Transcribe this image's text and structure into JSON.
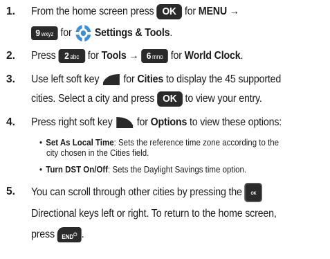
{
  "step1": {
    "num": "1.",
    "line1_a": "From the home screen press",
    "key_ok": "OK",
    "line1_b": "for",
    "menu": "MENU",
    "arrow": "→",
    "key9_digit": "9",
    "key9_letters": "wxyz",
    "line2_a": "for",
    "settings": "Settings & Tools",
    "line2_end": "."
  },
  "step2": {
    "num": "2.",
    "press": "Press",
    "key2_digit": "2",
    "key2_letters": "abc",
    "for1": "for",
    "tools": "Tools",
    "arrow": "→",
    "key6_digit": "6",
    "key6_letters": "mno",
    "for2": "for",
    "world_clock": "World Clock",
    "end": "."
  },
  "step3": {
    "num": "3.",
    "line1_a": "Use left soft key",
    "for": "for",
    "cities": "Cities",
    "line1_b": "to display the 45 supported",
    "line2_a": "cities. Select a city and press",
    "key_ok": "OK",
    "line2_b": "to view your entry."
  },
  "step4": {
    "num": "4.",
    "line1_a": "Press right soft key",
    "for": "for",
    "options": "Options",
    "line1_b": "to view these options:",
    "bullets": [
      {
        "bullet": "•",
        "title": "Set As Local Time",
        "text": ": Sets the reference time zone according to the",
        "cont": "city chosen in the Cities field."
      },
      {
        "bullet": "•",
        "title": "Turn DST On/Off",
        "text": ": Sets the Daylight Savings time option.",
        "cont": ""
      }
    ]
  },
  "step5": {
    "num": "5.",
    "line1": "You can scroll through other cities by pressing the",
    "key_small_ok": "OK",
    "line2": "Directional keys left or right. To return to the home screen,",
    "line3": "press",
    "key_end": "END",
    "end": "."
  },
  "colors": {
    "key_bg": "#2a2a2a",
    "key_text": "#ffffff",
    "gear_blue": "#3a8fd6",
    "text": "#1a1a1a"
  },
  "icons": {
    "settings": "gear-settings-icon",
    "left_soft_key": "left-soft-key-icon",
    "right_soft_key": "right-soft-key-icon"
  }
}
